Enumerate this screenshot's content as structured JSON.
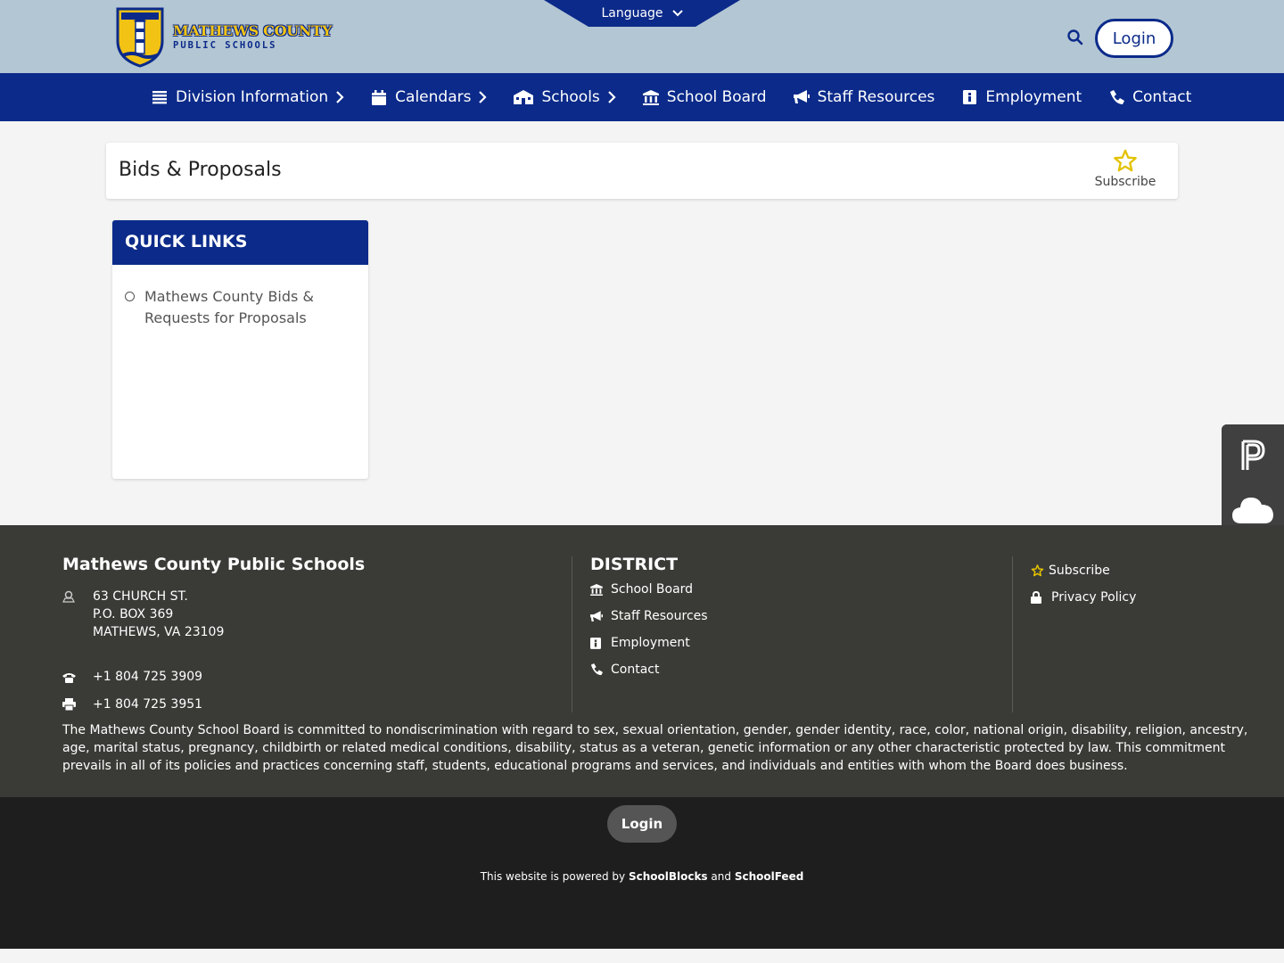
{
  "header": {
    "logo_line1": "MATHEWS COUNTY",
    "logo_line2": "PUBLIC SCHOOLS",
    "language_label": "Language",
    "login_label": "Login"
  },
  "nav": {
    "items": [
      {
        "label": "Division Information",
        "icon": "list-icon",
        "has_submenu": true
      },
      {
        "label": "Calendars",
        "icon": "calendar-icon",
        "has_submenu": true
      },
      {
        "label": "Schools",
        "icon": "school-icon",
        "has_submenu": true
      },
      {
        "label": "School Board",
        "icon": "building-icon",
        "has_submenu": false
      },
      {
        "label": "Staff Resources",
        "icon": "megaphone-icon",
        "has_submenu": false
      },
      {
        "label": "Employment",
        "icon": "id-badge-icon",
        "has_submenu": false
      },
      {
        "label": "Contact",
        "icon": "phone-icon",
        "has_submenu": false
      }
    ]
  },
  "page": {
    "title": "Bids & Proposals",
    "subscribe_label": "Subscribe"
  },
  "quick_links": {
    "heading": "QUICK LINKS",
    "items": [
      "Mathews County Bids & Requests for Proposals"
    ]
  },
  "footer": {
    "school_name": "Mathews County Public Schools",
    "address": [
      "63 CHURCH ST.",
      "P.O. BOX 369",
      "MATHEWS, VA 23109"
    ],
    "phone": "+1 804 725 3909",
    "fax": "+1 804 725 3951",
    "district_heading": "DISTRICT",
    "district_links": [
      "School Board",
      "Staff Resources",
      "Employment",
      "Contact"
    ],
    "extra_links": [
      "Subscribe",
      "Privacy Policy"
    ],
    "notice": "The Mathews County School Board is committed to nondiscrimination with regard to sex, sexual orientation, gender, gender identity, race, color, national origin, disability, religion, ancestry, age, marital status, pregnancy, childbirth or related medical conditions, disability, status as a veteran, genetic information or any other characteristic protected by law. This commitment prevails in all of its policies and practices concerning staff, students, educational programs and services, and individuals and entities with whom the Board does business."
  },
  "bottom": {
    "login_label": "Login",
    "powered_prefix": "This website is powered by",
    "brand1": "SchoolBlocks",
    "and": "and",
    "brand2": "SchoolFeed"
  },
  "colors": {
    "brand_blue": "#0b2a8a",
    "header_bg": "#b3c6d3",
    "logo_gold": "#f2c315",
    "footer_bg": "#3a3a37"
  }
}
